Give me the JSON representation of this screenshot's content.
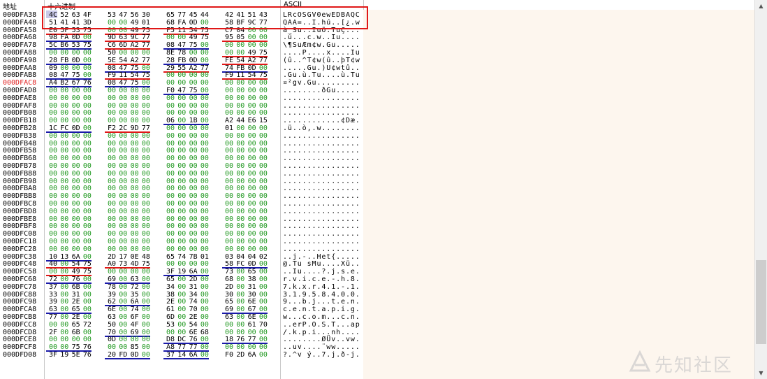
{
  "header": {
    "addr_label": "地址",
    "hex_label": "十六进制",
    "ascii_label": "ASCII"
  },
  "watermark": {
    "text": "先知社区"
  },
  "icons": {
    "scroll_up": "▲",
    "scroll_down": "▼",
    "watermark_logo": "xianzhi-logo-icon"
  },
  "colors": {
    "zero": "#229922",
    "nonzero": "#000000",
    "highlight_addr": "#e02020",
    "box": "#e01818",
    "underline_blue": "#1a1aa8",
    "underline_red": "#e01818"
  },
  "rows": [
    {
      "addr": "000DFA38",
      "hex": "4C 52 63 4F 53 47 56 30 65 77 45 44 42 41 51 43",
      "ascii": "LRcOSGV0ewEDBAQC"
    },
    {
      "addr": "000DFA48",
      "hex": "51 41 41 3D 00 00 49 01 68 FA 0D 00 58 BF 9C 77",
      "ascii": "QAA=..I.hú..[¿.w"
    },
    {
      "addr": "000DFA58",
      "hex": "E0 5F 53 75 00 00 49 75 F5 11 54 75 C7 04 00 00",
      "ascii": "à_Su..Iuõ.TuÇ..."
    },
    {
      "addr": "000DFA68",
      "hex": "98 FA 0D 00 9D 63 9C 77 00 00 49 75 95 05 00 00",
      "ascii": ".ú...c.w..Iu...."
    },
    {
      "addr": "000DFA78",
      "hex": "5C B6 53 75 C6 6D A2 77 08 47 75 00 00 00 00 00",
      "ascii": "\\¶SuÆm¢w.Gu....."
    },
    {
      "addr": "000DFA88",
      "hex": "00 00 00 00 50 00 00 00 8E 78 00 00 00 00 49 75",
      "ascii": "....P....x....Iu"
    },
    {
      "addr": "000DFA98",
      "hex": "28 FB 0D 00 5E 54 A2 77 28 FB 0D 00 FE 54 A2 77",
      "ascii": "(û..^T¢w(û..þT¢w"
    },
    {
      "addr": "000DFAA8",
      "hex": "09 00 00 00 08 47 75 00 29 55 A2 77 74 FB 0D 00",
      "ascii": ".....Gu.)U¢wtû.."
    },
    {
      "addr": "000DFAB8",
      "hex": "08 47 75 00 F9 11 54 75 00 00 00 00 F9 11 54 75",
      "ascii": ".Gu.ù.Tu....ù.Tu"
    },
    {
      "addr": "000DFAC8",
      "hex": "A4 B2 67 76 08 47 75 00 00 00 00 00 00 00 00 00",
      "ascii": "¤²gv.Gu.........",
      "hl": true
    },
    {
      "addr": "000DFAD8",
      "hex": "00 00 00 00 00 00 00 00 F0 47 75 00 00 00 00 00",
      "ascii": "........ðGu....."
    },
    {
      "addr": "000DFAE8",
      "hex": "00 00 00 00 00 00 00 00 00 00 00 00 00 00 00 00",
      "ascii": "................"
    },
    {
      "addr": "000DFAF8",
      "hex": "00 00 00 00 00 00 00 00 00 00 00 00 00 00 00 00",
      "ascii": "................"
    },
    {
      "addr": "000DFB08",
      "hex": "00 00 00 00 00 00 00 00 00 00 00 00 00 00 00 00",
      "ascii": "................"
    },
    {
      "addr": "000DFB18",
      "hex": "00 00 00 00 00 00 00 00 06 00 1B 00 A2 44 E6 15",
      "ascii": "............¢Dæ."
    },
    {
      "addr": "000DFB28",
      "hex": "1C FC 0D 00 F2 2C 9D 77 00 00 00 00 01 00 00 00",
      "ascii": ".ü..ò,.w........"
    },
    {
      "addr": "000DFB38",
      "hex": "00 00 00 00 00 00 00 00 00 00 00 00 00 00 00 00",
      "ascii": "................"
    },
    {
      "addr": "000DFB48",
      "hex": "00 00 00 00 00 00 00 00 00 00 00 00 00 00 00 00",
      "ascii": "................"
    },
    {
      "addr": "000DFB58",
      "hex": "00 00 00 00 00 00 00 00 00 00 00 00 00 00 00 00",
      "ascii": "................"
    },
    {
      "addr": "000DFB68",
      "hex": "00 00 00 00 00 00 00 00 00 00 00 00 00 00 00 00",
      "ascii": "................"
    },
    {
      "addr": "000DFB78",
      "hex": "00 00 00 00 00 00 00 00 00 00 00 00 00 00 00 00",
      "ascii": "................"
    },
    {
      "addr": "000DFB88",
      "hex": "00 00 00 00 00 00 00 00 00 00 00 00 00 00 00 00",
      "ascii": "................"
    },
    {
      "addr": "000DFB98",
      "hex": "00 00 00 00 00 00 00 00 00 00 00 00 00 00 00 00",
      "ascii": "................"
    },
    {
      "addr": "000DFBA8",
      "hex": "00 00 00 00 00 00 00 00 00 00 00 00 00 00 00 00",
      "ascii": "................"
    },
    {
      "addr": "000DFBB8",
      "hex": "00 00 00 00 00 00 00 00 00 00 00 00 00 00 00 00",
      "ascii": "................"
    },
    {
      "addr": "000DFBC8",
      "hex": "00 00 00 00 00 00 00 00 00 00 00 00 00 00 00 00",
      "ascii": "................"
    },
    {
      "addr": "000DFBD8",
      "hex": "00 00 00 00 00 00 00 00 00 00 00 00 00 00 00 00",
      "ascii": "................"
    },
    {
      "addr": "000DFBE8",
      "hex": "00 00 00 00 00 00 00 00 00 00 00 00 00 00 00 00",
      "ascii": "................"
    },
    {
      "addr": "000DFBF8",
      "hex": "00 00 00 00 00 00 00 00 00 00 00 00 00 00 00 00",
      "ascii": "................"
    },
    {
      "addr": "000DFC08",
      "hex": "00 00 00 00 00 00 00 00 00 00 00 00 00 00 00 00",
      "ascii": "................"
    },
    {
      "addr": "000DFC18",
      "hex": "00 00 00 00 00 00 00 00 00 00 00 00 00 00 00 00",
      "ascii": "................"
    },
    {
      "addr": "000DFC28",
      "hex": "00 00 00 00 00 00 00 00 00 00 00 00 00 00 00 00",
      "ascii": "................"
    },
    {
      "addr": "000DFC38",
      "hex": "10 13 6A 00 2D 17 0E 48 65 74 7B 01 03 04 04 02",
      "ascii": "..j.-..Het{....."
    },
    {
      "addr": "000DFC48",
      "hex": "40 00 54 75 A0 73 4D 75 00 00 00 00 58 FC 0D 00",
      "ascii": "@.Tu sMu....Xü.."
    },
    {
      "addr": "000DFC58",
      "hex": "00 00 49 75 00 00 00 00 3F 19 6A 00 73 00 65 00",
      "ascii": "..Iu....?.j.s.e."
    },
    {
      "addr": "000DFC68",
      "hex": "72 00 76 00 69 00 63 00 65 00 2D 00 68 00 38 00",
      "ascii": "r.v.i.c.e.-.h.8."
    },
    {
      "addr": "000DFC78",
      "hex": "37 00 6B 00 78 00 72 00 34 00 31 00 2D 00 31 00",
      "ascii": "7.k.x.r.4.1.-.1."
    },
    {
      "addr": "000DFC88",
      "hex": "33 00 31 00 39 00 35 00 38 00 34 00 30 00 30 00",
      "ascii": "3.1.9.5.8.4.0.0."
    },
    {
      "addr": "000DFC98",
      "hex": "39 00 2E 00 62 00 6A 00 2E 00 74 00 65 00 6E 00",
      "ascii": "9...b.j...t.e.n."
    },
    {
      "addr": "000DFCA8",
      "hex": "63 00 65 00 6E 00 74 00 61 00 70 00 69 00 67 00",
      "ascii": "c.e.n.t.a.p.i.g."
    },
    {
      "addr": "000DFCB8",
      "hex": "77 00 2E 00 63 00 6F 00 6D 00 2E 00 63 00 6E 00",
      "ascii": "w...c.o.m...c.n."
    },
    {
      "addr": "000DFCC8",
      "hex": "00 00 65 72 50 00 4F 00 53 00 54 00 00 00 61 70",
      "ascii": "..erP.O.S.T...ap"
    },
    {
      "addr": "000DFCD8",
      "hex": "2F 00 6B 00 70 00 69 00 00 00 6E 68 00 00 00 00",
      "ascii": "/.k.p.i...nh...."
    },
    {
      "addr": "000DFCE8",
      "hex": "00 00 00 00 0D 00 00 00 D8 DC 76 00 18 76 77 00",
      "ascii": "........ØÜv..vw."
    },
    {
      "addr": "000DFCF8",
      "hex": "00 00 75 76 00 00 85 00 A8 77 77 00 00 00 00 00",
      "ascii": "..uv....¨ww....."
    },
    {
      "addr": "000DFD08",
      "hex": "3F 19 5E 76 20 FD 0D 00 37 14 6A 00 F0 2D 6A 00",
      "ascii": "?.^v ý..7.j.ð-j."
    }
  ]
}
